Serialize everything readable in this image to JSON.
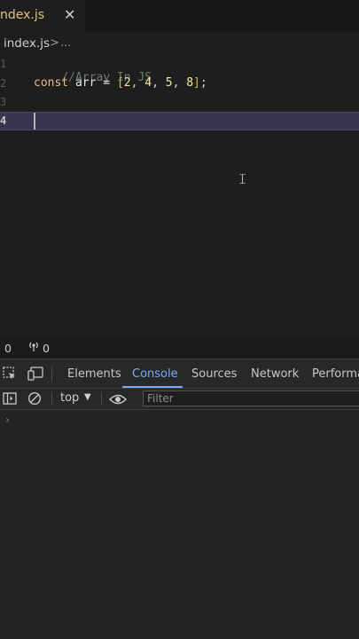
{
  "tab": {
    "label": "ndex.js",
    "close": "✕"
  },
  "breadcrumb": {
    "file": "index.js",
    "separator": ">",
    "more": "..."
  },
  "editor": {
    "line_numbers": [
      "1",
      "2",
      "3",
      "4"
    ],
    "comment": "//Array In JS",
    "keyword": "const",
    "var_name": "arr",
    "op": "=",
    "open_bracket": "[",
    "n1": "2",
    "n2": "4",
    "n3": "5",
    "n4": "8",
    "comma": ",",
    "close_bracket": "]",
    "semicolon": ";",
    "colors": {
      "comment": "#6a7a6a",
      "keyword": "#e5c07b",
      "number": "#f0e6a6",
      "bracket": "#d6b25e"
    }
  },
  "status": {
    "errors": "0",
    "ports": "0"
  },
  "devtools": {
    "tabs": [
      "Elements",
      "Console",
      "Sources",
      "Network",
      "Performan"
    ],
    "active_tab": "Console",
    "context": "top",
    "filter_placeholder": "Filter",
    "prompt": "›"
  }
}
